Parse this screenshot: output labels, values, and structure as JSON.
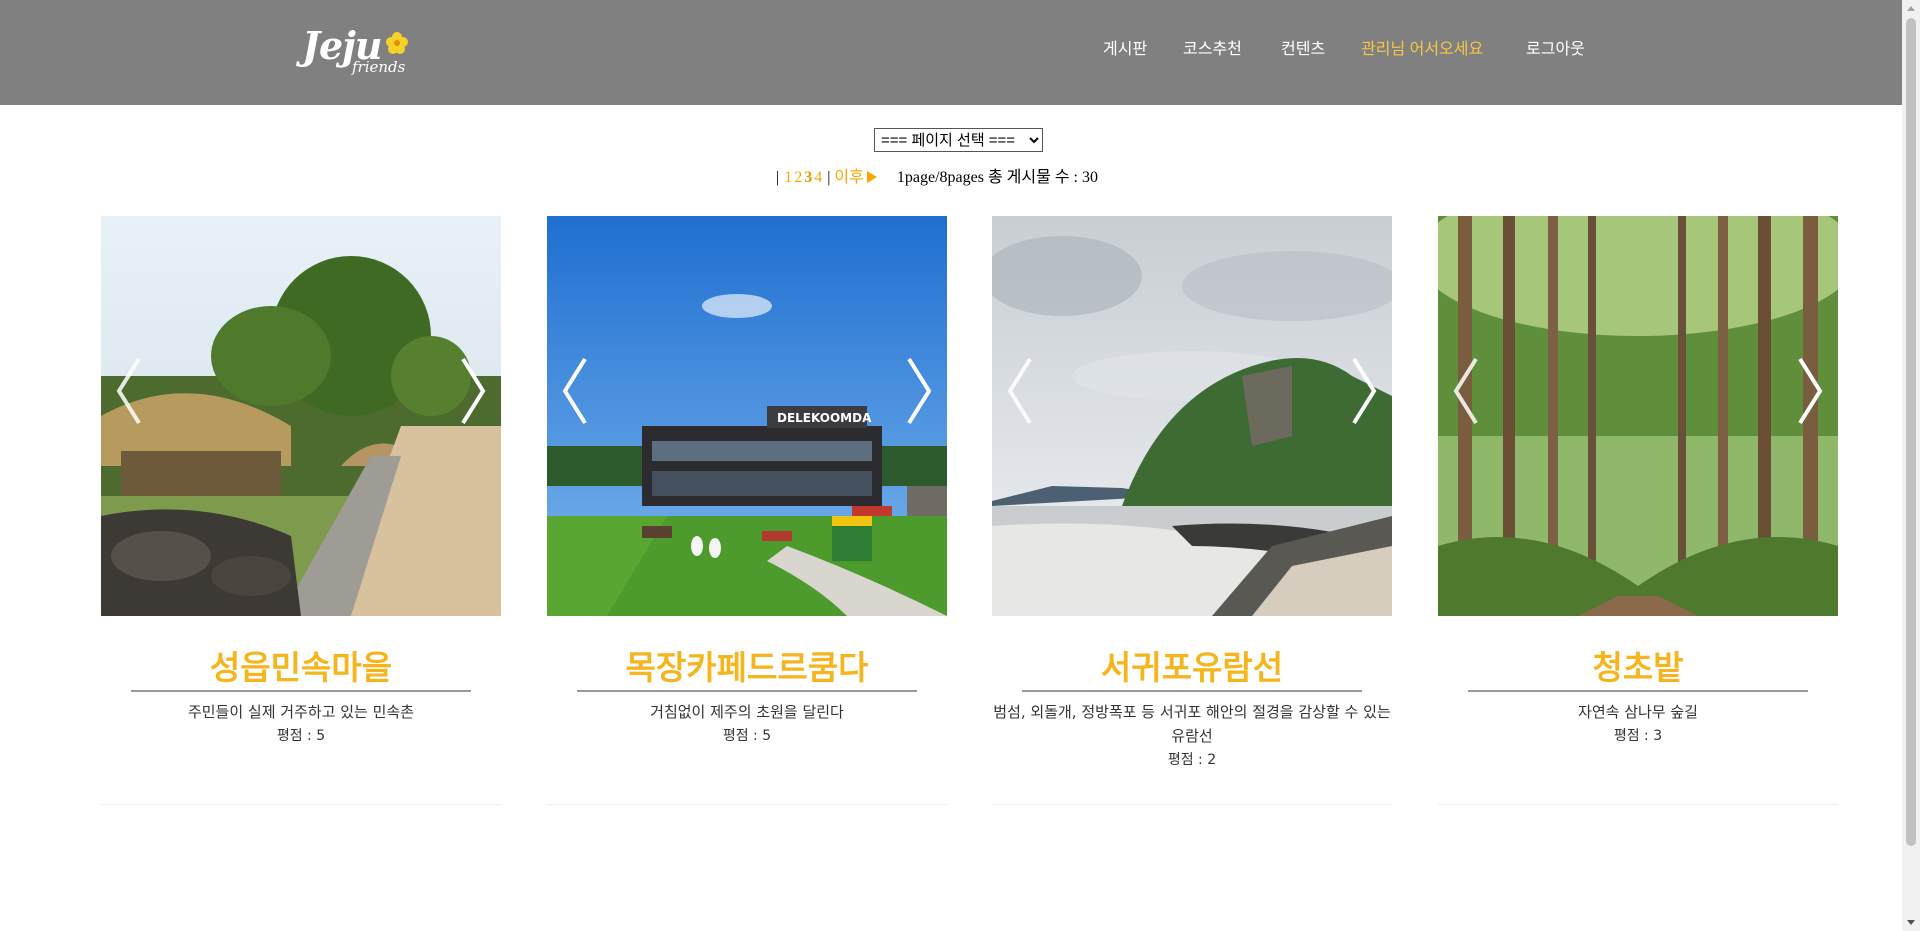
{
  "header": {
    "logo": {
      "main": "Jeju",
      "sub": "friends"
    },
    "nav": [
      "게시판",
      "코스추천",
      "컨텐츠",
      "관리님 어서오세요",
      "로그아웃"
    ],
    "colors": {
      "background": "#808080",
      "highlight": "#f6c744"
    }
  },
  "page_select": {
    "selected": "=== 페이지 선택 ==="
  },
  "pagination": {
    "pipe": "|",
    "pages": [
      "1",
      "2",
      "3",
      "4"
    ],
    "next_label": "이후",
    "info": "1page/8pages 총 게시물 수 : 30"
  },
  "cards": [
    {
      "title": "성읍민속마을",
      "desc": "주민들이 실제 거주하고 있는 민속촌",
      "rating": "평점 : 5",
      "image": "folk-village-photo"
    },
    {
      "title": "목장카페드르쿰다",
      "desc": "거침없이 제주의 초원을 달린다",
      "rating": "평점 : 5",
      "image": "ranch-cafe-photo"
    },
    {
      "title": "서귀포유람선",
      "desc": "범섬, 외돌개, 정방폭포 등 서귀포 해안의 절경을 감상할 수 있는 유람선",
      "rating": "평점 : 2",
      "image": "coastal-cliff-photo"
    },
    {
      "title": "청초밭",
      "desc": "자연속 삼나무 숲길",
      "rating": "평점 : 3",
      "image": "cedar-forest-photo"
    }
  ],
  "colors": {
    "title": "#f6b51d",
    "pager": "#f6a800"
  }
}
